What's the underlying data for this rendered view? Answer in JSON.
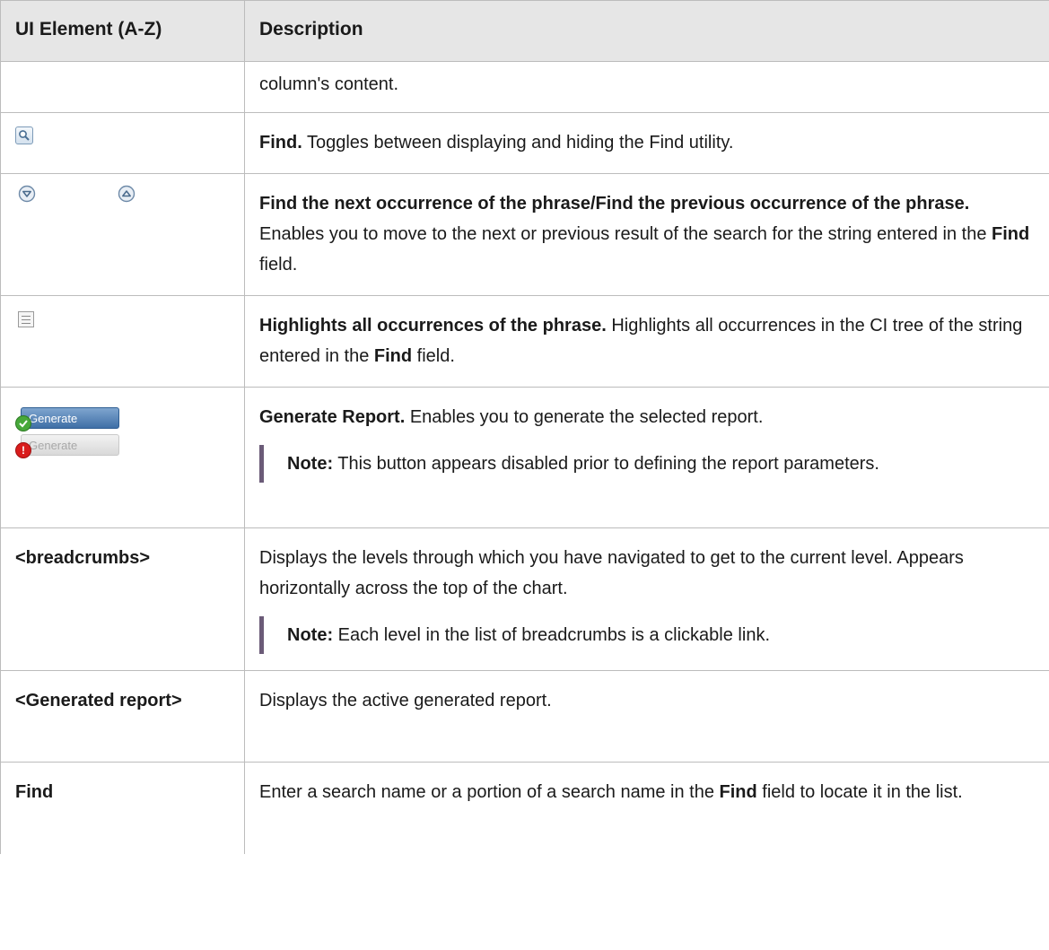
{
  "table": {
    "header": {
      "col1": "UI Element (A-Z)",
      "col2": "Description"
    },
    "rows": {
      "r0": {
        "desc": "column's content."
      },
      "r1": {
        "icon": "magnifier-icon",
        "title": "Find.",
        "desc": " Toggles between displaying and hiding the Find utility."
      },
      "r2": {
        "icons": [
          "find-next-icon",
          "find-previous-icon"
        ],
        "title": "Find the next occurrence of the phrase/Find the previous occurrence of the phrase.",
        "desc_a": " Enables you to move to the next or previous result of the search for the string entered in the ",
        "desc_bold": "Find",
        "desc_b": " field."
      },
      "r3": {
        "icon": "highlight-all-icon",
        "title": "Highlights all occurrences of the phrase.",
        "desc_a": " Highlights all occurrences in the CI tree of the string entered in the ",
        "desc_bold": "Find",
        "desc_b": " field."
      },
      "r4": {
        "button_active_label": "Generate",
        "button_disabled_label": "Generate",
        "error_mark": "!",
        "title": "Generate Report.",
        "desc": " Enables you to generate the selected report.",
        "note_label": "Note:",
        "note_text": "  This button appears disabled prior to defining the report parameters."
      },
      "r5": {
        "element": "<breadcrumbs>",
        "desc": "Displays the levels through which you have navigated to get to the current level. Appears horizontally across the top of the chart.",
        "note_label": "Note:",
        "note_text": "  Each level in the list of breadcrumbs is a clickable link."
      },
      "r6": {
        "element": "<Generated report>",
        "desc": "Displays the active generated report."
      },
      "r7": {
        "element": "Find",
        "desc_a": "Enter a search name or a portion of a search name in the ",
        "desc_bold": "Find",
        "desc_b": " field to locate it in the list."
      }
    }
  },
  "colors": {
    "header_bg": "#e6e6e6",
    "border": "#bcbcbc",
    "note_bar": "#6b5b78",
    "button_blue": "#3f6fa6"
  }
}
